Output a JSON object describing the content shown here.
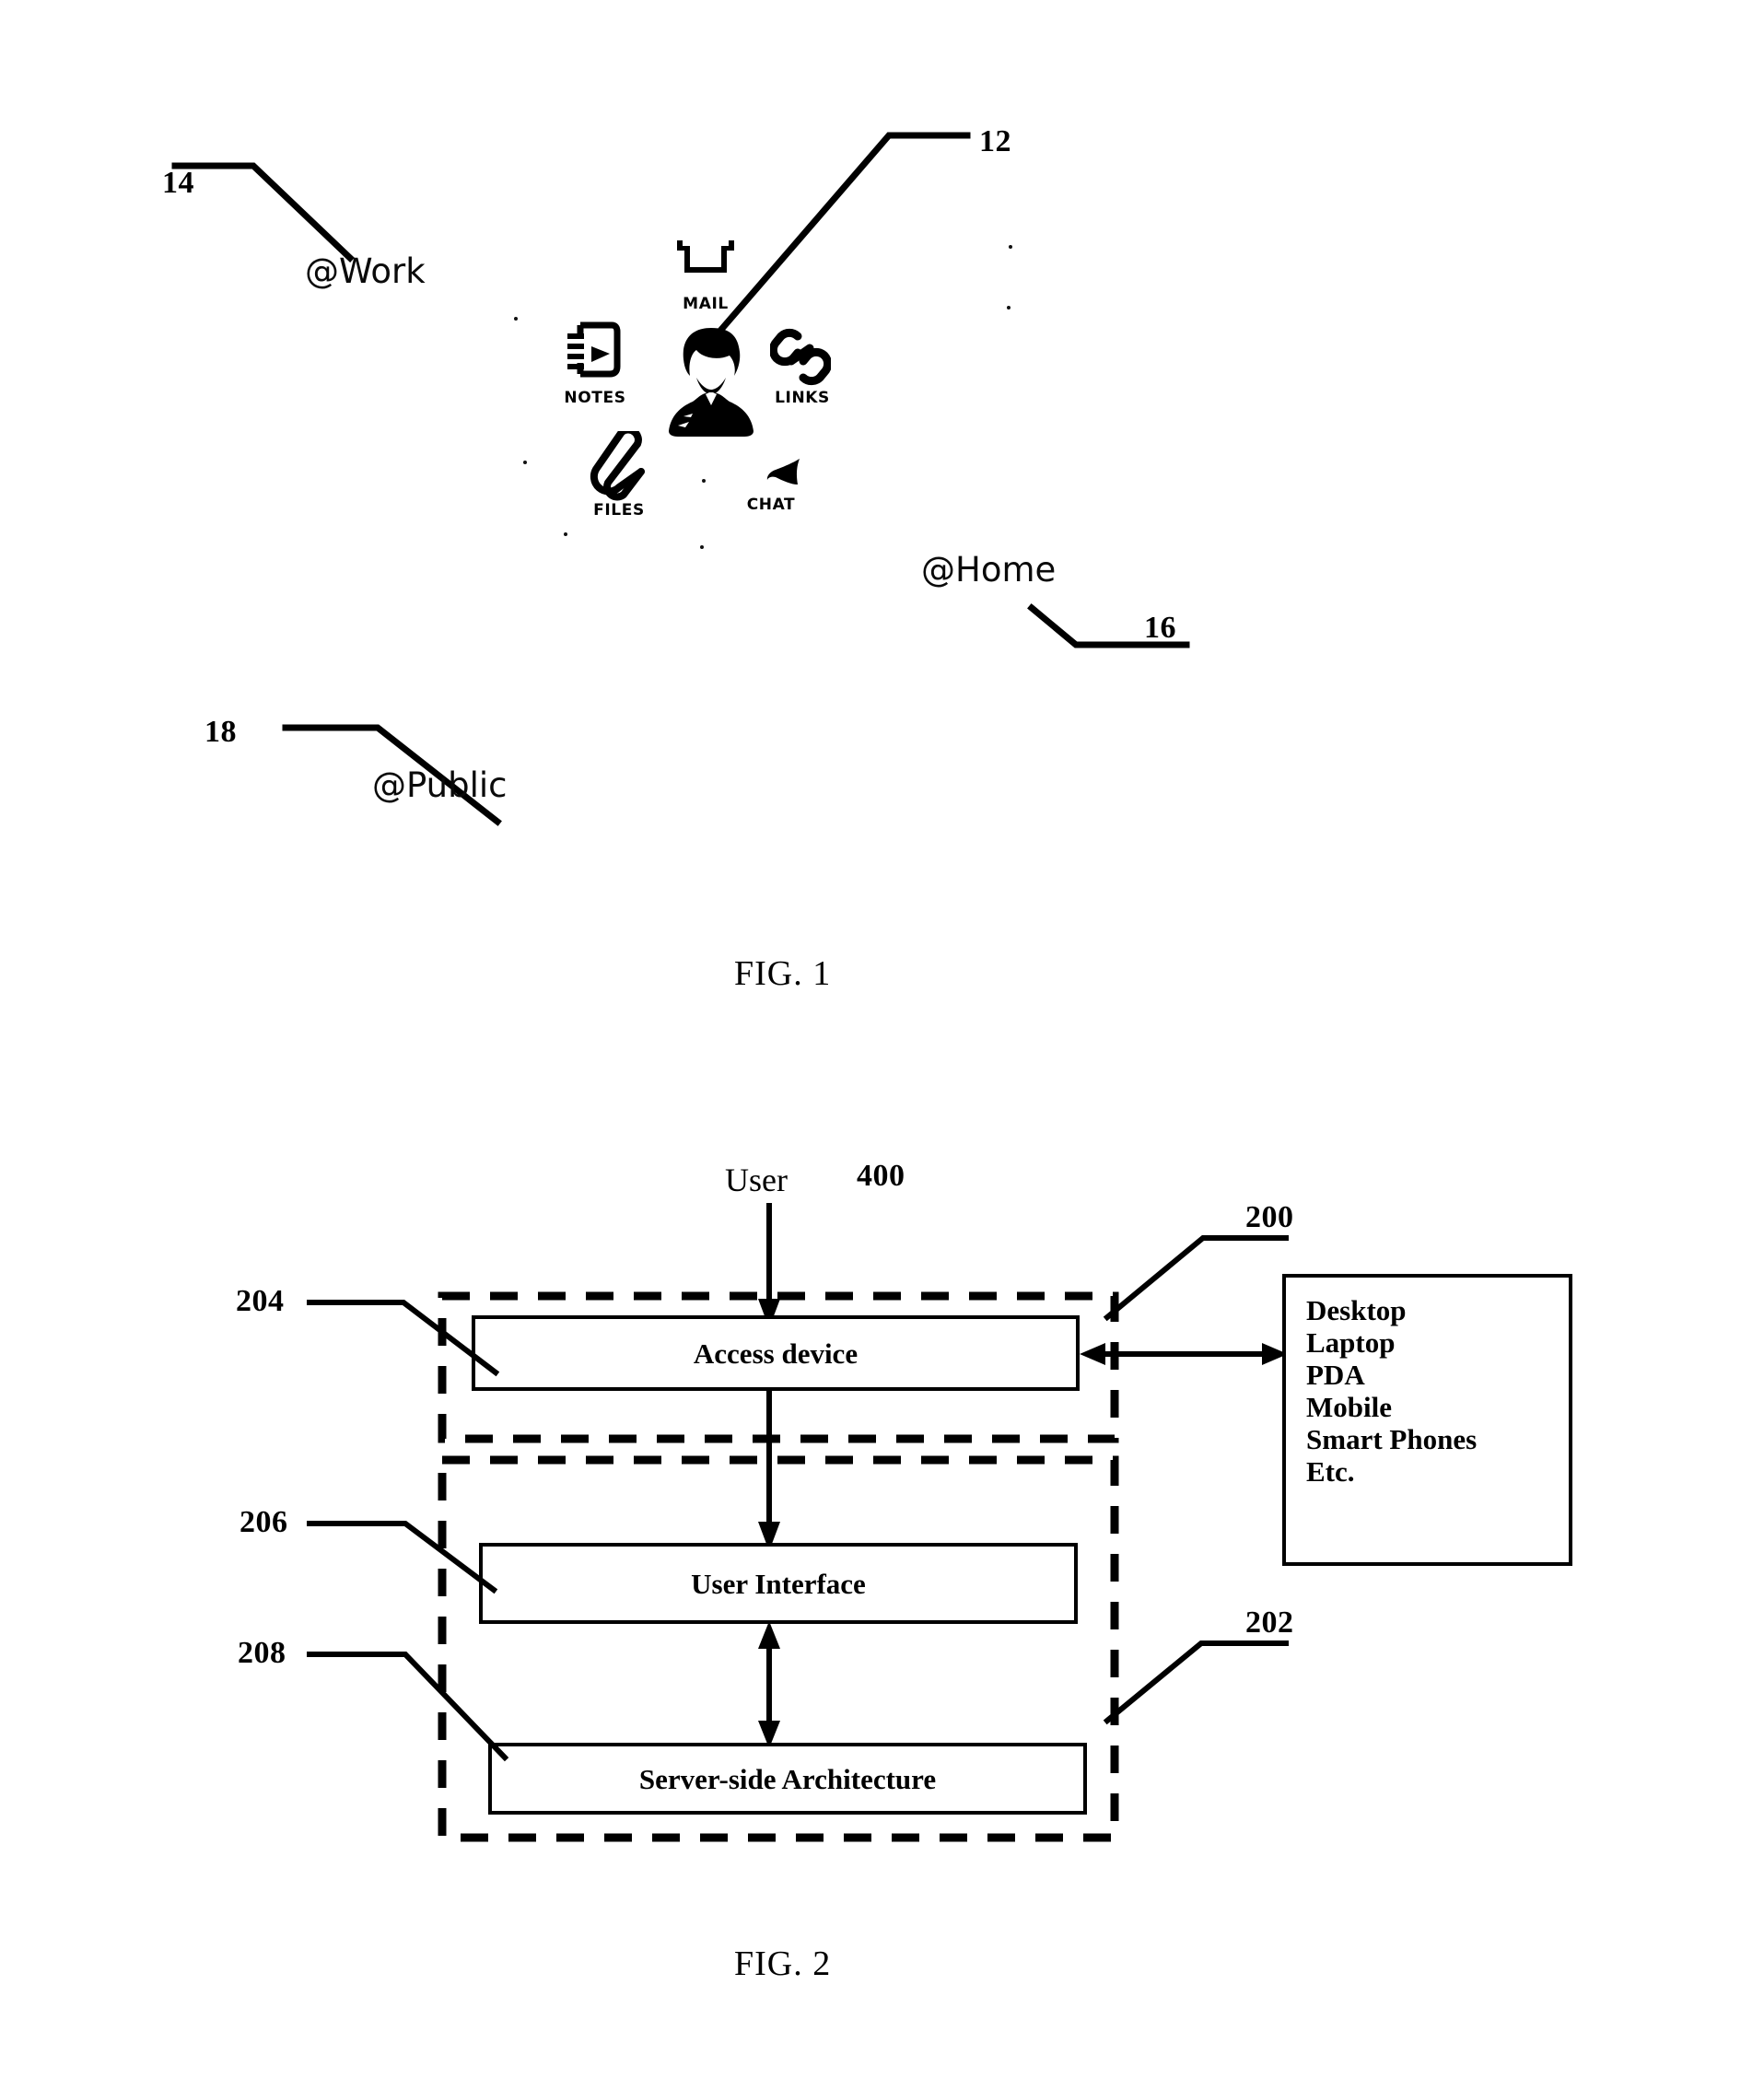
{
  "figure1": {
    "caption": "FIG. 1",
    "refs": [
      {
        "id": "ref-14",
        "text": "14"
      },
      {
        "id": "ref-12",
        "text": "12"
      },
      {
        "id": "ref-16",
        "text": "16"
      },
      {
        "id": "ref-18",
        "text": "18"
      }
    ],
    "context_labels": [
      {
        "id": "at-work",
        "text": "@Work"
      },
      {
        "id": "at-home",
        "text": "@Home"
      },
      {
        "id": "at-public",
        "text": "@Public"
      }
    ],
    "icons": [
      {
        "name": "mail-icon",
        "caption": "MAIL"
      },
      {
        "name": "notes-icon",
        "caption": "NOTES"
      },
      {
        "name": "links-icon",
        "caption": "LINKS"
      },
      {
        "name": "files-icon",
        "caption": "FILES"
      },
      {
        "name": "chat-icon",
        "caption": "CHAT"
      },
      {
        "name": "person-avatar-icon",
        "caption": ""
      }
    ]
  },
  "figure2": {
    "caption": "FIG. 2",
    "user_label": "User",
    "user_ref": "400",
    "refs": [
      {
        "id": "ref-200",
        "text": "200"
      },
      {
        "id": "ref-202",
        "text": "202"
      },
      {
        "id": "ref-204",
        "text": "204"
      },
      {
        "id": "ref-206",
        "text": "206"
      },
      {
        "id": "ref-208",
        "text": "208"
      }
    ],
    "boxes": [
      {
        "id": "access-device",
        "label": "Access device"
      },
      {
        "id": "user-interface",
        "label": "User Interface"
      },
      {
        "id": "server-side-architecture",
        "label": "Server-side Architecture"
      }
    ],
    "device_list": [
      "Desktop",
      "Laptop",
      "PDA",
      "Mobile",
      "Smart Phones",
      "Etc."
    ]
  },
  "colors": {
    "ink": "#000000",
    "paper": "#ffffff"
  }
}
